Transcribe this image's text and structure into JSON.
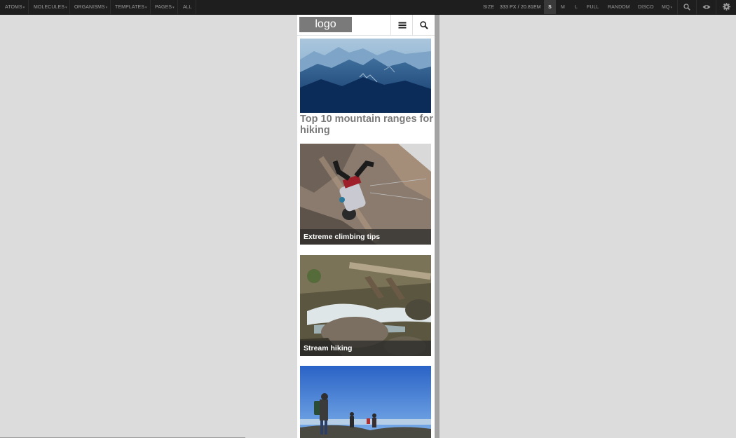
{
  "toolbar": {
    "nav": [
      {
        "label": "ATOMS",
        "caret": "▾"
      },
      {
        "label": "MOLECULES",
        "caret": "▾"
      },
      {
        "label": "ORGANISMS",
        "caret": "▾"
      },
      {
        "label": "TEMPLATES",
        "caret": "▾"
      },
      {
        "label": "PAGES",
        "caret": "▾"
      },
      {
        "label": "ALL"
      }
    ],
    "size_label": "SIZE",
    "size_px": "333",
    "size_px_unit": "PX /",
    "size_em": "20.81EM",
    "sizes": [
      {
        "label": "S",
        "active": true
      },
      {
        "label": "M"
      },
      {
        "label": "L"
      }
    ],
    "full_label": "FULL",
    "random_label": "RANDOM",
    "disco_label": "DISCO",
    "mq_label": "MQ",
    "mq_caret": "▾",
    "icons": [
      "search-icon",
      "eye-icon",
      "gear-icon"
    ]
  },
  "site": {
    "logo": "logo",
    "icons": [
      "hamburger-menu-icon",
      "search-icon"
    ]
  },
  "articles": [
    {
      "headline": "Top 10 mountain ranges for hiking",
      "image": "mountain-ranges-photo"
    },
    {
      "caption": "Extreme climbing tips",
      "image": "rock-climber-photo"
    },
    {
      "caption": "Stream hiking",
      "image": "stream-waterfall-photo"
    },
    {
      "image": "hikers-summit-photo"
    }
  ]
}
